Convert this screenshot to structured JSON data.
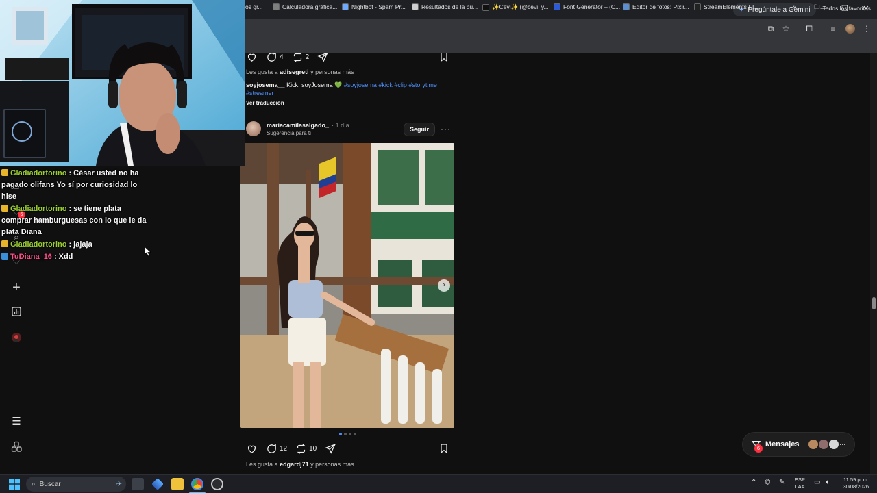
{
  "browser": {
    "tab_partial_title": "os gr...",
    "gemini_button": "Pregúntale a Gemini",
    "bookmarks": [
      {
        "label": "Calculadora gráfica...",
        "color": "#7e7e7e"
      },
      {
        "label": "Nightbot - Spam Pr...",
        "color": "#6da9ff"
      },
      {
        "label": "Resultados de la bú...",
        "color": "#cfcfcf"
      },
      {
        "label": "✨Cevi✨ (@cevi_y...",
        "color": "#111111"
      },
      {
        "label": "Font Generator – (C...",
        "color": "#2d5bd7"
      },
      {
        "label": "Editor de fotos: Pixlr...",
        "color": "#5b8fd0"
      },
      {
        "label": "StreamElements | T...",
        "color": "#222222"
      }
    ],
    "favorites_label": "Todos los favoritos"
  },
  "threads": {
    "prev_post": {
      "reply_count": "4",
      "repost_count": "2",
      "likes_prefix": "Les gusta a",
      "likes_user": "adisegreti",
      "likes_suffix": "y personas más",
      "caption_user": "soyjosema__",
      "caption_text": "Kick: soyJosema 💚",
      "tags": [
        "#soyjosema",
        "#kick",
        "#clip",
        "#storytime",
        "#streamer"
      ],
      "translate_label": "Ver traducción"
    },
    "post": {
      "username": "mariacamilasalgado_",
      "time": "1 día",
      "subtitle": "Sugerencia para ti",
      "follow_label": "Seguir",
      "more_label": "···",
      "reply_count": "12",
      "repost_count": "10",
      "likes_prefix": "Les gusta a",
      "likes_user": "edgardj71",
      "likes_suffix": "y personas más",
      "carousel_total": 4,
      "carousel_index": 0
    },
    "messages": {
      "label": "Mensajes",
      "badge": "6",
      "more": "···"
    },
    "rail": {
      "activity_badge": "6"
    }
  },
  "chat": [
    {
      "user": "Gladiadortorino",
      "message": "César usted no ha pagado olifans Yo sí por curiosidad lo hise",
      "user_color": "green",
      "icon": "crown"
    },
    {
      "user": "Gladiadortorino",
      "message": "se tiene plata comprar hamburguesas con lo que le da plata Diana",
      "user_color": "green",
      "icon": "crown"
    },
    {
      "user": "Gladiadortorino",
      "message": "jajaja",
      "user_color": "green",
      "icon": "crown"
    },
    {
      "user": "TuDiana_16",
      "message": "Xdd",
      "user_color": "pink",
      "icon": "badges"
    }
  ],
  "chat_separator": ":",
  "taskbar": {
    "search_placeholder": "Buscar",
    "lang_top": "ESP",
    "lang_bottom": "LAA",
    "time": "11:59 p. m.",
    "date": "30/08/2026"
  },
  "colors": {
    "accent_blue": "#4e8ef7",
    "badge_red": "#ff3040",
    "chat_green": "#9acd32",
    "chat_pink": "#ff4f8b"
  }
}
